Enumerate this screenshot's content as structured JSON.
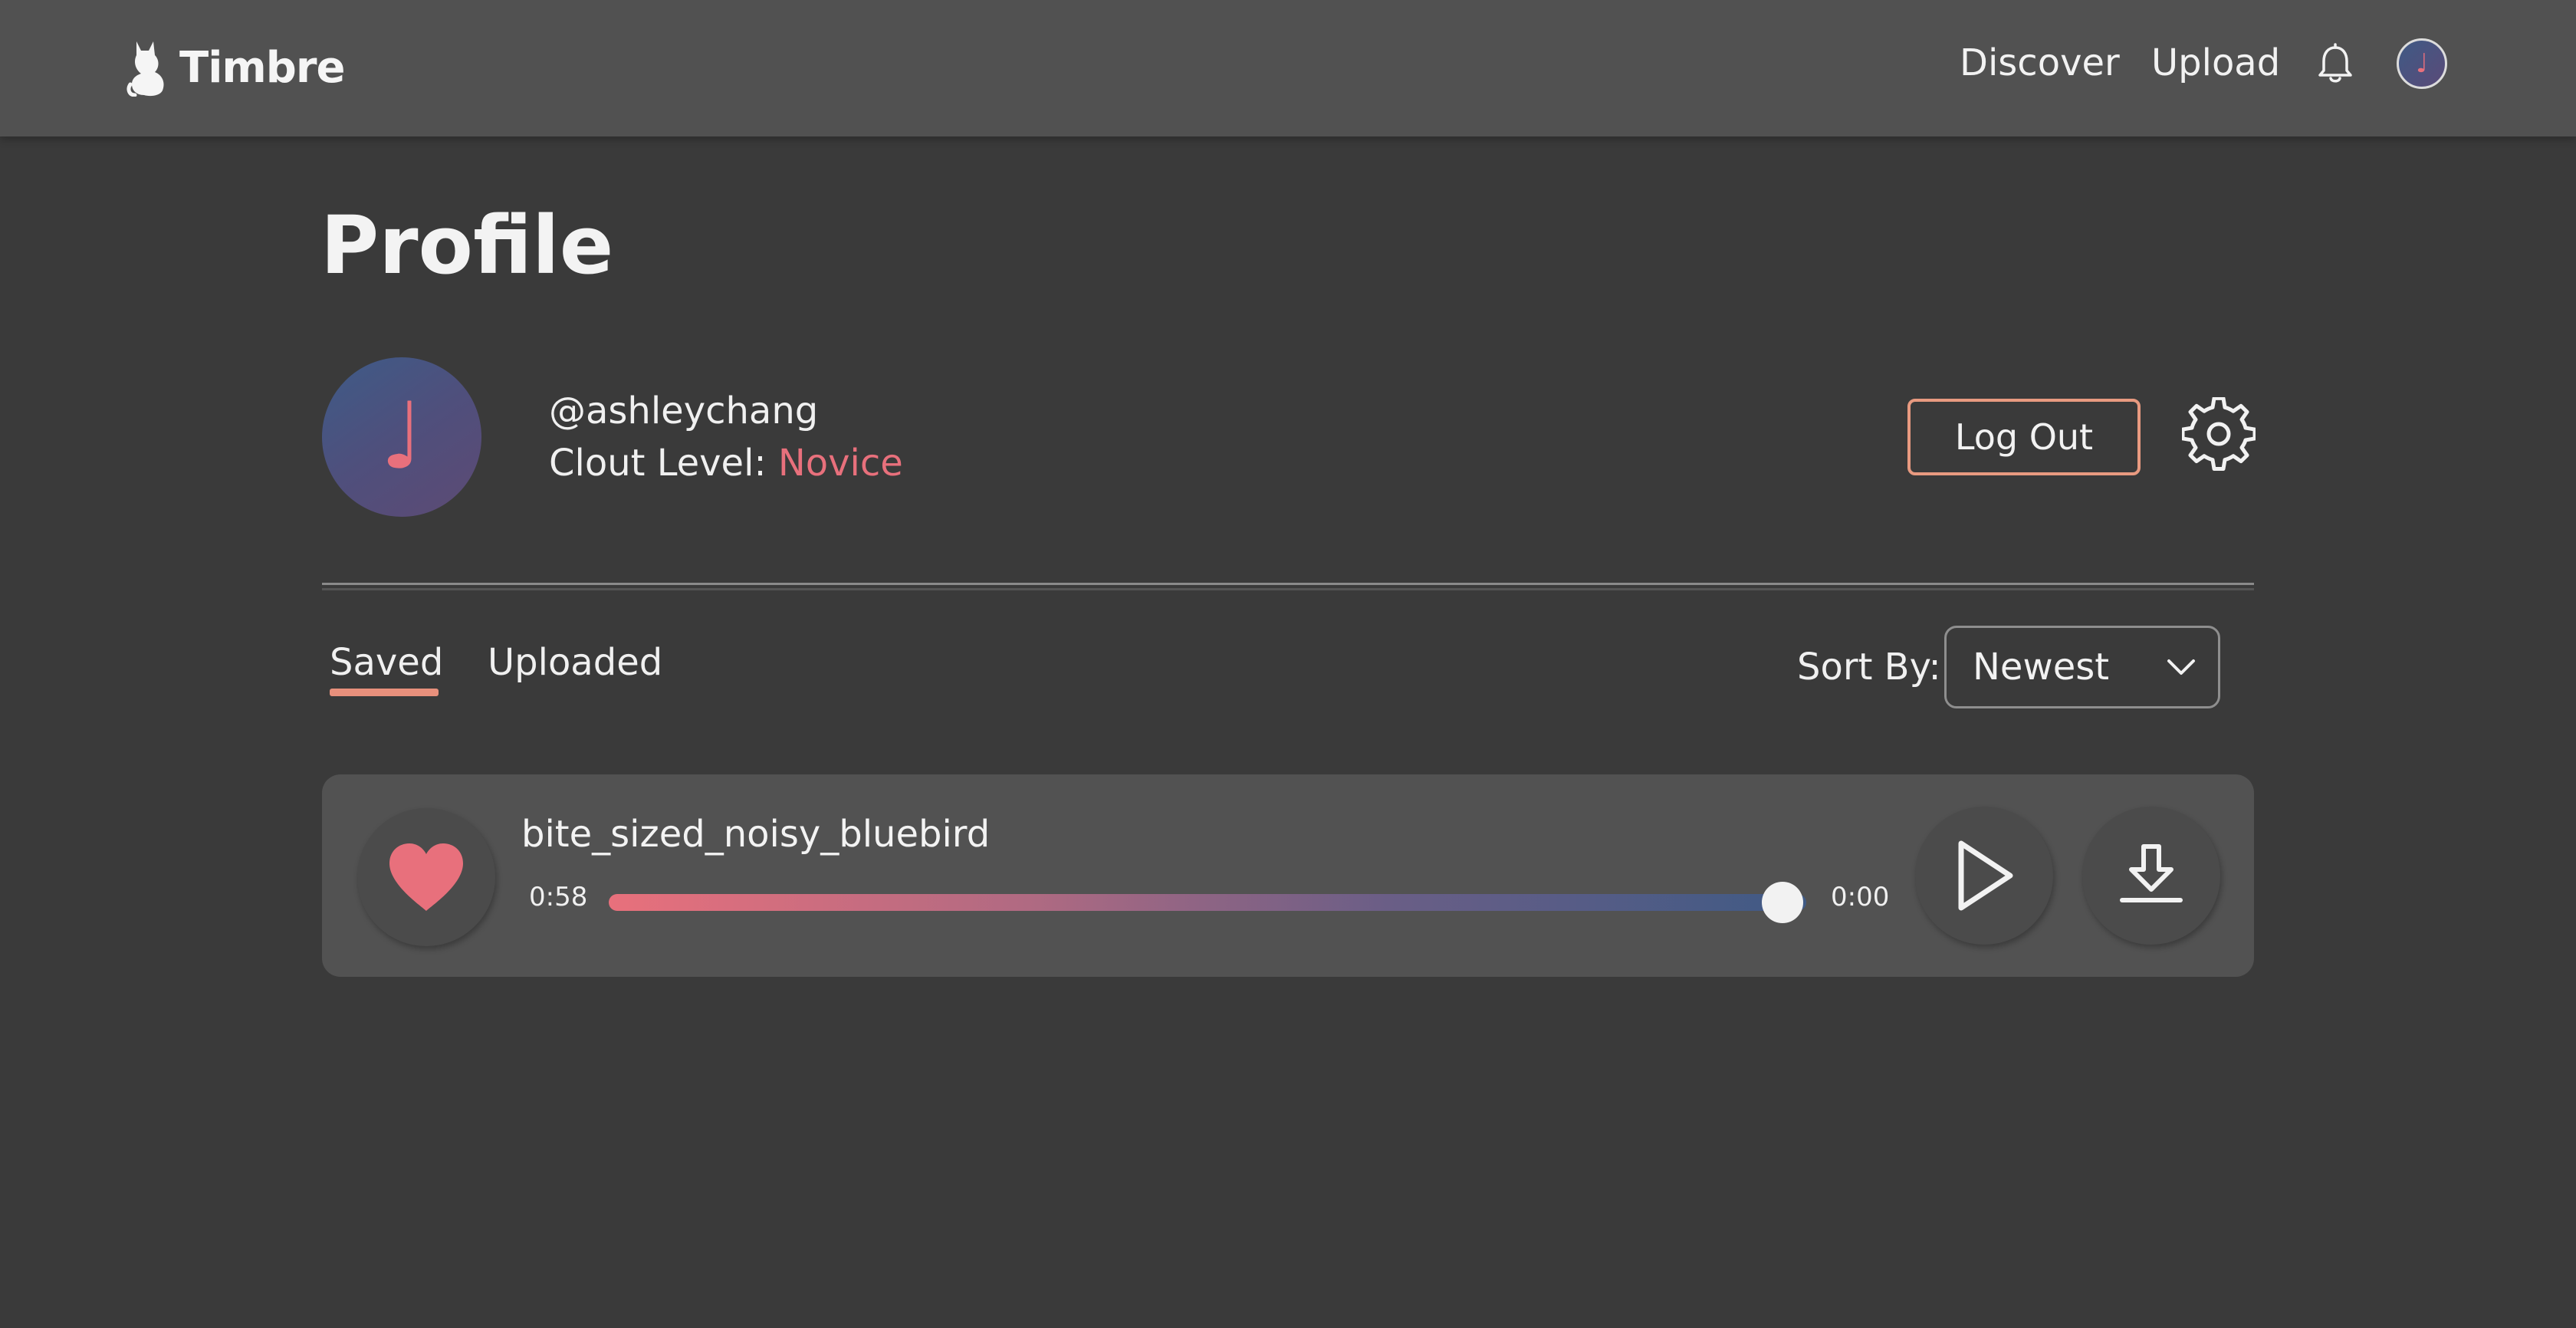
{
  "nav": {
    "brand": "Timbre",
    "links": [
      "Discover",
      "Upload"
    ],
    "avatar_glyph": "♩"
  },
  "profile": {
    "title": "Profile",
    "avatar_glyph": "♩",
    "username": "@ashleychang",
    "clout_label": "Clout Level: ",
    "clout_level": "Novice",
    "logout_label": "Log Out"
  },
  "tabs": {
    "items": [
      {
        "label": "Saved",
        "active": true
      },
      {
        "label": "Uploaded",
        "active": false
      }
    ]
  },
  "sort": {
    "label": "Sort By:",
    "value": "Newest"
  },
  "tracks": [
    {
      "title": "bite_sized_noisy_bluebird",
      "elapsed": "0:58",
      "remaining": "0:00",
      "progress": 0.98,
      "liked": true
    }
  ],
  "icons": {
    "logo": "cat-logo-icon",
    "bell": "bell-icon",
    "settings": "gear-icon",
    "heart": "heart-icon",
    "play": "play-icon",
    "download": "download-icon",
    "chevron": "chevron-down-icon"
  },
  "colors": {
    "accent": "#e8707c",
    "accent_border": "#e89a80",
    "blue": "#3f5a85",
    "nav_bg": "#515151",
    "page_bg": "#3a3a3a",
    "card_bg": "#525252"
  }
}
